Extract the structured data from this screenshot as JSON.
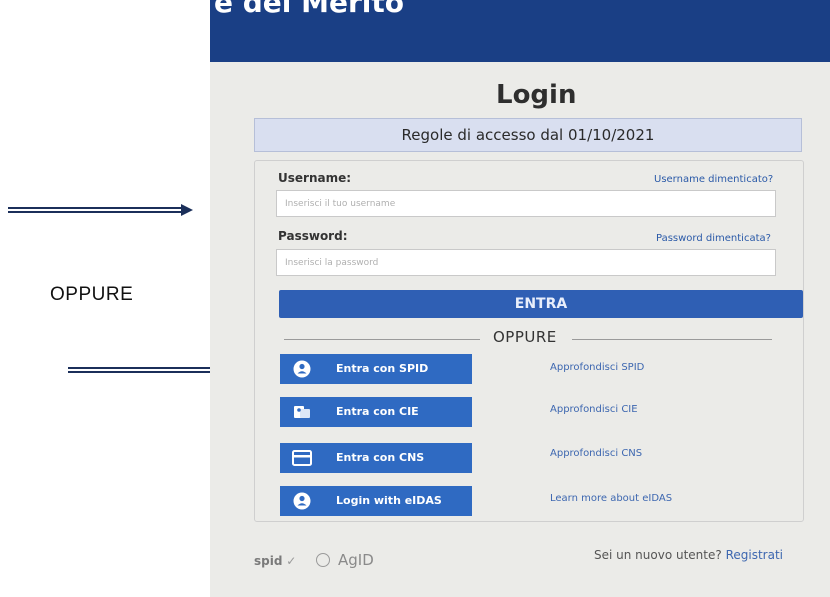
{
  "header": {
    "banner_text": "e del Merito"
  },
  "login": {
    "title": "Login",
    "notice": "Regole di accesso dal 01/10/2021",
    "username_label": "Username:",
    "username_forgot": "Username dimenticato?",
    "username_placeholder": "Inserisci il tuo username",
    "password_label": "Password:",
    "password_forgot": "Password dimenticata?",
    "password_placeholder": "Inserisci la password",
    "submit": "ENTRA",
    "divider": "OPPURE"
  },
  "auth_options": [
    {
      "label": "Entra con SPID",
      "icon": "user-icon",
      "learn": "Approfondisci SPID"
    },
    {
      "label": "Entra con CIE",
      "icon": "id-card-icon",
      "learn": "Approfondisci CIE"
    },
    {
      "label": "Entra con CNS",
      "icon": "card-icon",
      "learn": "Approfondisci CNS"
    },
    {
      "label": "Login with eIDAS",
      "icon": "user-icon",
      "learn": "Learn more about eIDAS"
    }
  ],
  "footer": {
    "spid_logo": "spid",
    "agid_logo": "AgID",
    "new_user": "Sei un nuovo utente?",
    "register": "Registrati"
  },
  "annotations": {
    "side_label": "OPPURE"
  },
  "colors": {
    "brand_blue": "#2f5fb4",
    "header_navy": "#1a3f85",
    "link_blue": "#3d67b0"
  }
}
